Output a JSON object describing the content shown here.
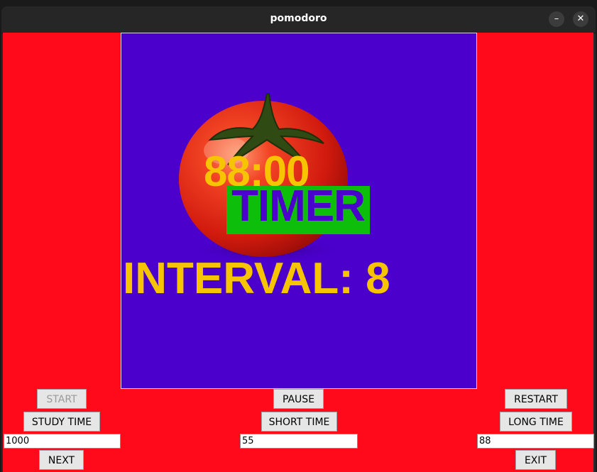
{
  "window": {
    "title": "pomodoro",
    "minimize_icon": "minimize-icon",
    "close_icon": "close-icon",
    "minimize_glyph": "–",
    "close_glyph": "✕"
  },
  "colors": {
    "background": "#ff0a1a",
    "canvas": "#4b00cc",
    "timer_text": "#f7c402",
    "timer_label_bg": "#0dbf0a",
    "timer_label_text": "#4b00cc"
  },
  "canvas": {
    "tomato_image": "tomato-icon",
    "timer": "88:00",
    "label": "TIMER",
    "interval": "INTERVAL: 8"
  },
  "left": {
    "start_label": "START",
    "study_time_label": "STUDY TIME",
    "study_value": "1000",
    "next_label": "NEXT"
  },
  "center": {
    "pause_label": "PAUSE",
    "short_time_label": "SHORT TIME",
    "short_value": "55"
  },
  "right": {
    "restart_label": "RESTART",
    "long_time_label": "LONG TIME",
    "long_value": "88",
    "exit_label": "EXIT"
  }
}
